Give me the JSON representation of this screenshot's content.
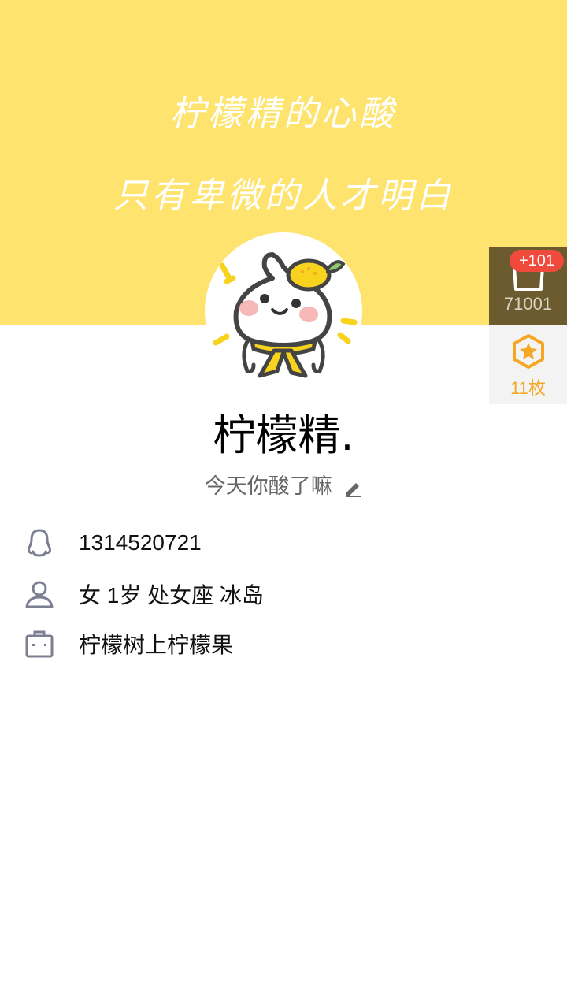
{
  "banner": {
    "line1": "柠檬精的心酸",
    "line2": "只有卑微的人才明白",
    "background_color": "#FEE46E"
  },
  "profile": {
    "nickname": "柠檬精.",
    "signature": "今天你酸了嘛",
    "avatar_icon": "lemon-character-avatar"
  },
  "side_panel": {
    "coins": {
      "badge": "+101",
      "count": "71001",
      "icon": "cup-icon",
      "background_color": "#6B5B2E"
    },
    "medals": {
      "count": "11枚",
      "icon": "star-medal-icon",
      "color": "#F5A623"
    }
  },
  "info": {
    "qq_number": "1314520721",
    "details": "女  1岁  处女座  冰岛",
    "company": "柠檬树上柠檬果"
  }
}
